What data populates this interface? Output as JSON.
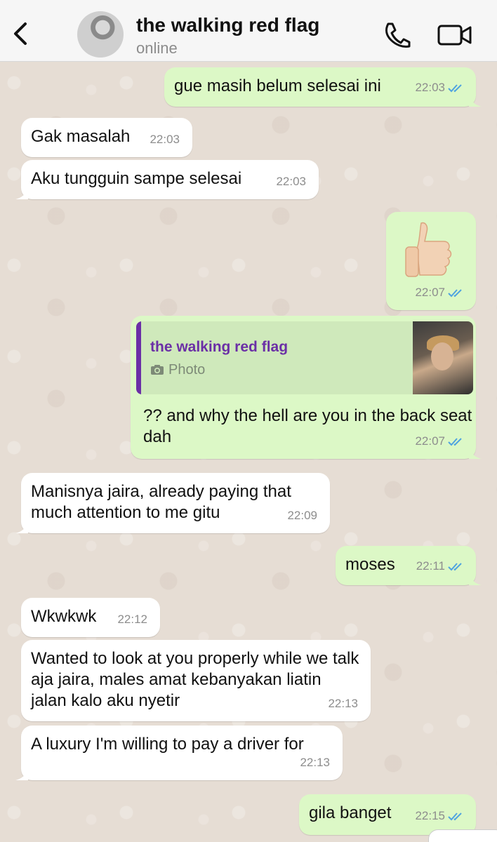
{
  "header": {
    "contact_name": "the walking red flag",
    "status": "online",
    "icons": [
      "chevron-left-icon",
      "phone-icon",
      "video-camera-icon"
    ]
  },
  "colors": {
    "outgoing_bubble": "#dcf8c6",
    "incoming_bubble": "#ffffff",
    "read_ticks": "#4fa3e0",
    "quote_accent": "#6b2fa6"
  },
  "messages": [
    {
      "dir": "out",
      "text": "gue masih belum selesai ini",
      "time": "22:03",
      "read": true
    },
    {
      "dir": "in",
      "text": "Gak masalah",
      "time": "22:03"
    },
    {
      "dir": "in",
      "text": "Aku tungguin sampe selesai",
      "time": "22:03"
    },
    {
      "dir": "out",
      "emoji": "thumbs-up",
      "time": "22:07",
      "read": true
    },
    {
      "dir": "out",
      "reply_to": {
        "name": "the walking red flag",
        "type": "Photo"
      },
      "text": "?? and why the hell are you in the back seat dah",
      "time": "22:07",
      "read": true
    },
    {
      "dir": "in",
      "text": "Manisnya jaira, already paying that much attention to me gitu",
      "time": "22:09"
    },
    {
      "dir": "out",
      "text": "moses",
      "time": "22:11",
      "read": true
    },
    {
      "dir": "in",
      "text": "Wkwkwk",
      "time": "22:12"
    },
    {
      "dir": "in",
      "text": "Wanted to look at you properly while we talk aja jaira, males amat kebanyakan liatin jalan kalo aku nyetir",
      "time": "22:13"
    },
    {
      "dir": "in",
      "text": "A luxury I'm willing to pay a driver for",
      "time": "22:13"
    },
    {
      "dir": "out",
      "text": "gila banget",
      "time": "22:15",
      "read": true
    }
  ]
}
